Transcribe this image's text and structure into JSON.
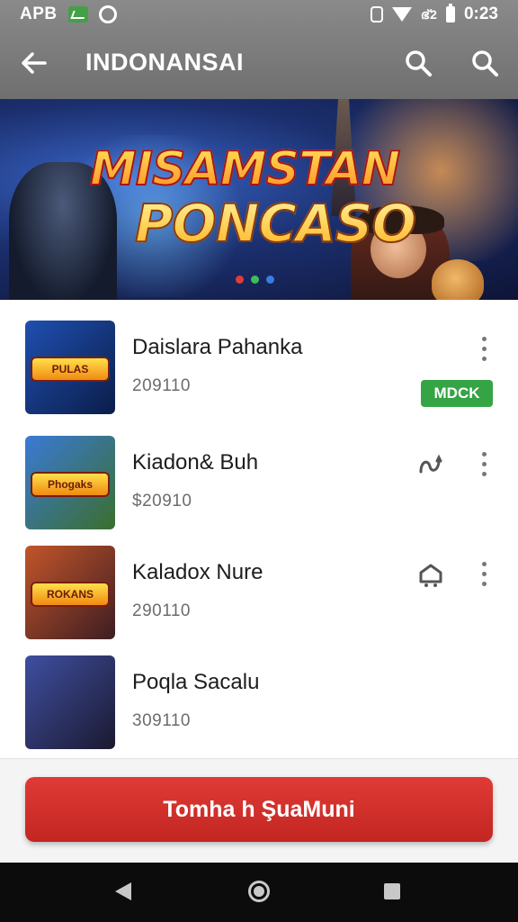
{
  "status_bar": {
    "left_label": "APB",
    "network_text": "ഭ്2",
    "time": "0:23"
  },
  "app_bar": {
    "title": "INDONANSAI",
    "back_icon": "arrow-left-icon",
    "search_icons": [
      "search-icon",
      "search-icon"
    ]
  },
  "banner": {
    "title_line1": "MISAMSTAN",
    "title_line2": "PONCASO",
    "dots": [
      {
        "color": "#e33b3b"
      },
      {
        "color": "#3bbf5a"
      },
      {
        "color": "#3b7be3"
      }
    ]
  },
  "games": [
    {
      "title": "Daislara Pahanka",
      "subtitle": "209110",
      "thumb_label": "PULAS",
      "thumb_colors": [
        "#1f4fb0",
        "#0b1d4a"
      ],
      "action": "more"
    },
    {
      "title": "Kiadon& Buh",
      "subtitle": "$20910",
      "thumb_label": "Phogaks",
      "thumb_colors": [
        "#3a7ad6",
        "#3b6e2d"
      ],
      "action_icon": "wave-icon",
      "action": "more"
    },
    {
      "title": "Kaladox Nure",
      "subtitle": "290110",
      "thumb_label": "ROKANS",
      "thumb_colors": [
        "#c2552a",
        "#3d1d22"
      ],
      "action_icon": "house-icon",
      "action": "more"
    },
    {
      "title": "Poqla Sacalu",
      "subtitle": "309110",
      "thumb_label": "",
      "thumb_colors": [
        "#3f4fa0",
        "#1b1930"
      ],
      "badge": "MDCK"
    }
  ],
  "cta": {
    "label": "Tomha h ŞuaMuni"
  },
  "colors": {
    "accent_red": "#d32f2f",
    "badge_green": "#34a445"
  }
}
